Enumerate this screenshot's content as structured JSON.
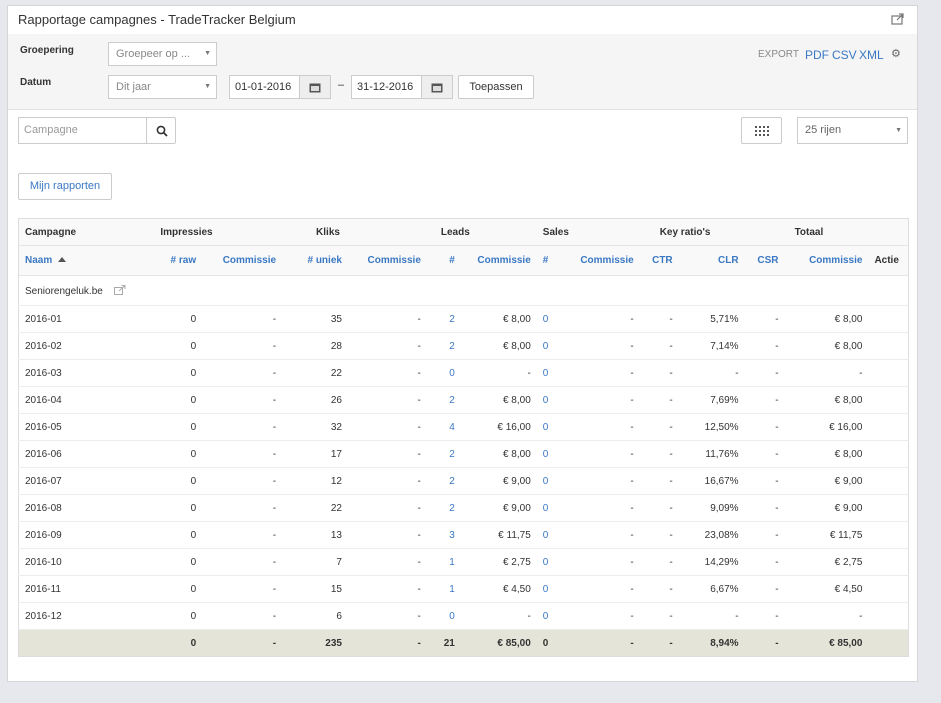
{
  "panel": {
    "title": "Rapportage campagnes - TradeTracker Belgium"
  },
  "filters": {
    "groepering_label": "Groepering",
    "groepering_placeholder": "Groepeer op ...",
    "datum_label": "Datum",
    "datum_value": "Dit jaar",
    "date_from": "01-01-2016",
    "date_sep": "–",
    "date_to": "31-12-2016",
    "apply_label": "Toepassen",
    "export_label": "EXPORT",
    "export_pdf": "PDF",
    "export_csv": "CSV",
    "export_xml": "XML"
  },
  "toolbar": {
    "search_placeholder": "Campagne",
    "rows_select": "25 rijen",
    "my_reports": "Mijn rapporten"
  },
  "table": {
    "group_headers": [
      "Campagne",
      "Impressies",
      "Kliks",
      "Leads",
      "Sales",
      "Key ratio's",
      "Totaal"
    ],
    "col_headers": [
      "Naam",
      "# raw",
      "Commissie",
      "# uniek",
      "Commissie",
      "#",
      "Commissie",
      "#",
      "Commissie",
      "CTR",
      "CLR",
      "CSR",
      "Commissie",
      "Actie"
    ],
    "campaign": "Seniorengeluk.be",
    "rows": [
      [
        "2016-01",
        "0",
        "-",
        "35",
        "-",
        "2",
        "€ 8,00",
        "0",
        "-",
        "-",
        "5,71%",
        "-",
        "€ 8,00"
      ],
      [
        "2016-02",
        "0",
        "-",
        "28",
        "-",
        "2",
        "€ 8,00",
        "0",
        "-",
        "-",
        "7,14%",
        "-",
        "€ 8,00"
      ],
      [
        "2016-03",
        "0",
        "-",
        "22",
        "-",
        "0",
        "-",
        "0",
        "-",
        "-",
        "-",
        "-",
        "-"
      ],
      [
        "2016-04",
        "0",
        "-",
        "26",
        "-",
        "2",
        "€ 8,00",
        "0",
        "-",
        "-",
        "7,69%",
        "-",
        "€ 8,00"
      ],
      [
        "2016-05",
        "0",
        "-",
        "32",
        "-",
        "4",
        "€ 16,00",
        "0",
        "-",
        "-",
        "12,50%",
        "-",
        "€ 16,00"
      ],
      [
        "2016-06",
        "0",
        "-",
        "17",
        "-",
        "2",
        "€ 8,00",
        "0",
        "-",
        "-",
        "11,76%",
        "-",
        "€ 8,00"
      ],
      [
        "2016-07",
        "0",
        "-",
        "12",
        "-",
        "2",
        "€ 9,00",
        "0",
        "-",
        "-",
        "16,67%",
        "-",
        "€ 9,00"
      ],
      [
        "2016-08",
        "0",
        "-",
        "22",
        "-",
        "2",
        "€ 9,00",
        "0",
        "-",
        "-",
        "9,09%",
        "-",
        "€ 9,00"
      ],
      [
        "2016-09",
        "0",
        "-",
        "13",
        "-",
        "3",
        "€ 11,75",
        "0",
        "-",
        "-",
        "23,08%",
        "-",
        "€ 11,75"
      ],
      [
        "2016-10",
        "0",
        "-",
        "7",
        "-",
        "1",
        "€ 2,75",
        "0",
        "-",
        "-",
        "14,29%",
        "-",
        "€ 2,75"
      ],
      [
        "2016-11",
        "0",
        "-",
        "15",
        "-",
        "1",
        "€ 4,50",
        "0",
        "-",
        "-",
        "6,67%",
        "-",
        "€ 4,50"
      ],
      [
        "2016-12",
        "0",
        "-",
        "6",
        "-",
        "0",
        "-",
        "0",
        "-",
        "-",
        "-",
        "-",
        "-"
      ]
    ],
    "totals": [
      "",
      "0",
      "-",
      "235",
      "-",
      "21",
      "€ 85,00",
      "0",
      "-",
      "-",
      "8,94%",
      "-",
      "€ 85,00"
    ]
  },
  "colors": {
    "link": "#3a78c3",
    "total_bg": "#e4e4d9"
  }
}
